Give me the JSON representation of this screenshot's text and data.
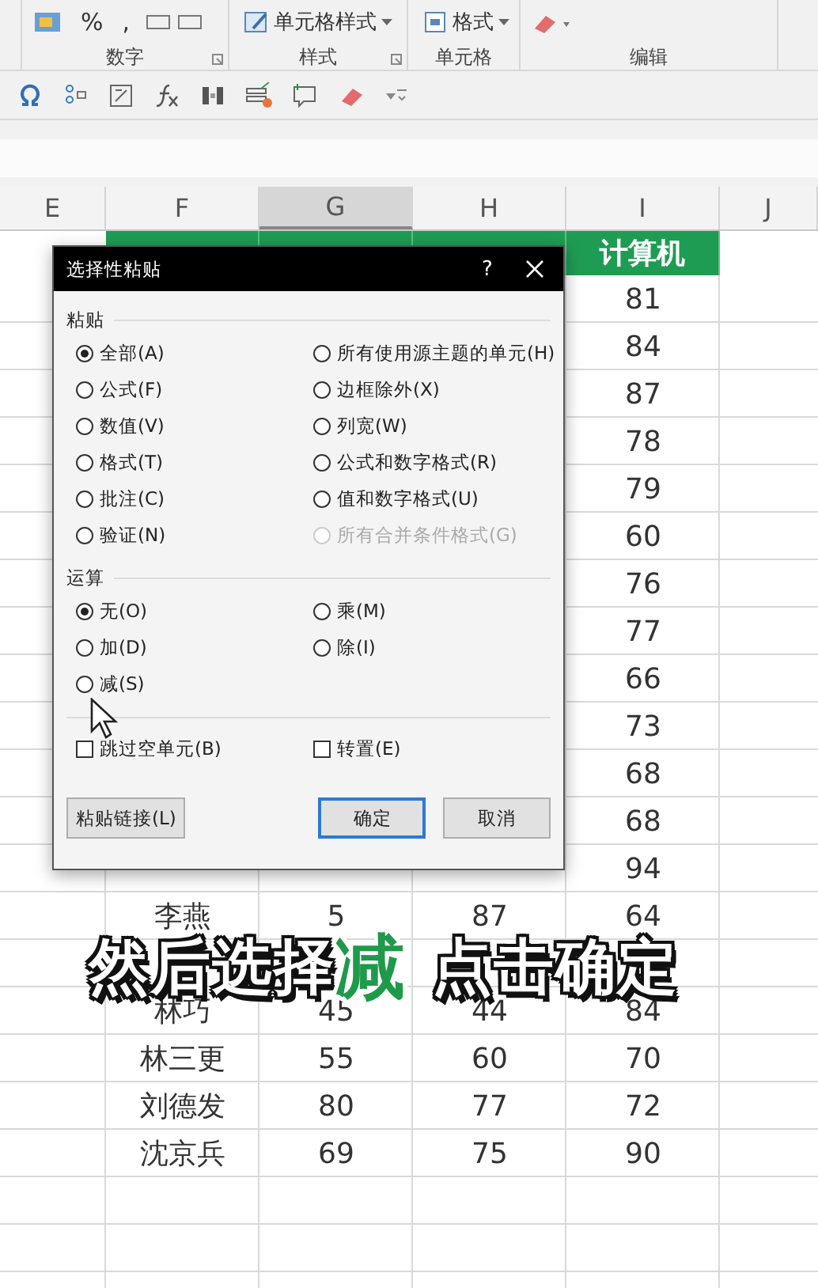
{
  "ribbon": {
    "number_symbols": [
      "%",
      ","
    ],
    "style_button": "单元格样式",
    "format_button": "格式",
    "groups": [
      "数字",
      "样式",
      "单元格",
      "编辑"
    ]
  },
  "sheet": {
    "columns": [
      {
        "label": "E",
        "selected": false
      },
      {
        "label": "F",
        "selected": false
      },
      {
        "label": "G",
        "selected": true
      },
      {
        "label": "H",
        "selected": false
      },
      {
        "label": "I",
        "selected": false
      },
      {
        "label": "J",
        "selected": false
      }
    ],
    "header_label": "计算机",
    "rows": [
      {
        "cells": [
          "",
          "",
          "",
          "",
          "81"
        ]
      },
      {
        "cells": [
          "",
          "",
          "",
          "",
          "84"
        ]
      },
      {
        "cells": [
          "",
          "",
          "",
          "",
          "87"
        ]
      },
      {
        "cells": [
          "",
          "",
          "",
          "",
          "78"
        ]
      },
      {
        "cells": [
          "",
          "",
          "",
          "",
          "79"
        ]
      },
      {
        "cells": [
          "",
          "",
          "",
          "",
          "60"
        ]
      },
      {
        "cells": [
          "",
          "",
          "",
          "",
          "76"
        ]
      },
      {
        "cells": [
          "",
          "",
          "",
          "",
          "77"
        ]
      },
      {
        "cells": [
          "",
          "",
          "",
          "",
          "66"
        ]
      },
      {
        "cells": [
          "",
          "",
          "",
          "",
          "73"
        ]
      },
      {
        "cells": [
          "",
          "",
          "",
          "",
          "68"
        ]
      },
      {
        "cells": [
          "",
          "",
          "",
          "",
          "68"
        ]
      },
      {
        "cells": [
          "",
          "",
          "",
          "",
          "94"
        ]
      },
      {
        "cells": [
          "",
          "李燕",
          "5",
          "87",
          "64"
        ]
      },
      {
        "cells": [
          "",
          "",
          "",
          "",
          ""
        ]
      },
      {
        "cells": [
          "",
          "林巧",
          "45",
          "44",
          "84"
        ]
      },
      {
        "cells": [
          "",
          "林三更",
          "55",
          "60",
          "70"
        ]
      },
      {
        "cells": [
          "",
          "刘德发",
          "80",
          "77",
          "72"
        ]
      },
      {
        "cells": [
          "",
          "沈京兵",
          "69",
          "75",
          "90"
        ]
      }
    ]
  },
  "dialog": {
    "title": "选择性粘贴",
    "help": "?",
    "paste_section": "粘贴",
    "paste_options": [
      {
        "label": "全部(A)",
        "selected": true,
        "disabled": false
      },
      {
        "label": "所有使用源主题的单元(H)",
        "selected": false,
        "disabled": false
      },
      {
        "label": "公式(F)",
        "selected": false,
        "disabled": false
      },
      {
        "label": "边框除外(X)",
        "selected": false,
        "disabled": false
      },
      {
        "label": "数值(V)",
        "selected": false,
        "disabled": false
      },
      {
        "label": "列宽(W)",
        "selected": false,
        "disabled": false
      },
      {
        "label": "格式(T)",
        "selected": false,
        "disabled": false
      },
      {
        "label": "公式和数字格式(R)",
        "selected": false,
        "disabled": false
      },
      {
        "label": "批注(C)",
        "selected": false,
        "disabled": false
      },
      {
        "label": "值和数字格式(U)",
        "selected": false,
        "disabled": false
      },
      {
        "label": "验证(N)",
        "selected": false,
        "disabled": false
      },
      {
        "label": "所有合并条件格式(G)",
        "selected": false,
        "disabled": true
      }
    ],
    "operation_section": "运算",
    "operation_options": [
      {
        "label": "无(O)",
        "selected": true,
        "disabled": false
      },
      {
        "label": "乘(M)",
        "selected": false,
        "disabled": false
      },
      {
        "label": "加(D)",
        "selected": false,
        "disabled": false
      },
      {
        "label": "除(I)",
        "selected": false,
        "disabled": false
      },
      {
        "label": "减(S)",
        "selected": false,
        "disabled": false
      }
    ],
    "checkboxes": [
      {
        "label": "跳过空单元(B)",
        "checked": false
      },
      {
        "label": "转置(E)",
        "checked": false
      }
    ],
    "buttons": [
      {
        "label": "粘贴链接(L)",
        "default": false
      },
      {
        "label": "确定",
        "default": true
      },
      {
        "label": "取消",
        "default": false
      }
    ]
  },
  "caption": {
    "parts": [
      {
        "text": "然后选择",
        "kind": "plain"
      },
      {
        "text": "减",
        "kind": "highlight"
      },
      {
        "text": "点击确定",
        "kind": "plain"
      }
    ]
  }
}
